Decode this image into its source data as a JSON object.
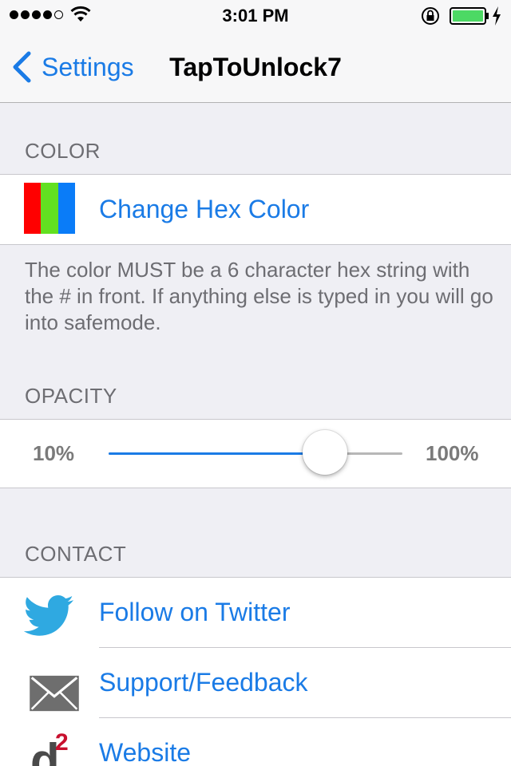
{
  "status_bar": {
    "time": "3:01 PM",
    "signal_bars": 4,
    "icons": [
      "wifi-icon",
      "orientation-lock-icon",
      "battery-icon",
      "charging-icon"
    ],
    "battery_color": "#4cd964"
  },
  "nav": {
    "back_label": "Settings",
    "title": "TapToUnlock7"
  },
  "sections": {
    "color": {
      "header": "COLOR",
      "cell_label": "Change Hex Color",
      "icon": "color-swatch-icon",
      "swatch_colors": [
        "#ff0000",
        "#62e021",
        "#0a7cf8"
      ],
      "footer": "The color MUST be a 6 character hex string with the # in front. If anything else is typed in you will go into safemode."
    },
    "opacity": {
      "header": "OPACITY",
      "min_label": "10%",
      "max_label": "100%",
      "slider_value": 0.736
    },
    "contact": {
      "header": "CONTACT",
      "items": [
        {
          "label": "Follow on Twitter",
          "icon": "twitter-bird-icon"
        },
        {
          "label": "Support/Feedback",
          "icon": "envelope-icon"
        },
        {
          "label": "Website",
          "icon": "d2-logo-icon"
        }
      ]
    }
  },
  "colors": {
    "accent": "#1a7be6",
    "background": "#efeff4",
    "header_text": "#6d6d72",
    "twitter": "#2fa9e1",
    "logo_red": "#c8102e"
  }
}
